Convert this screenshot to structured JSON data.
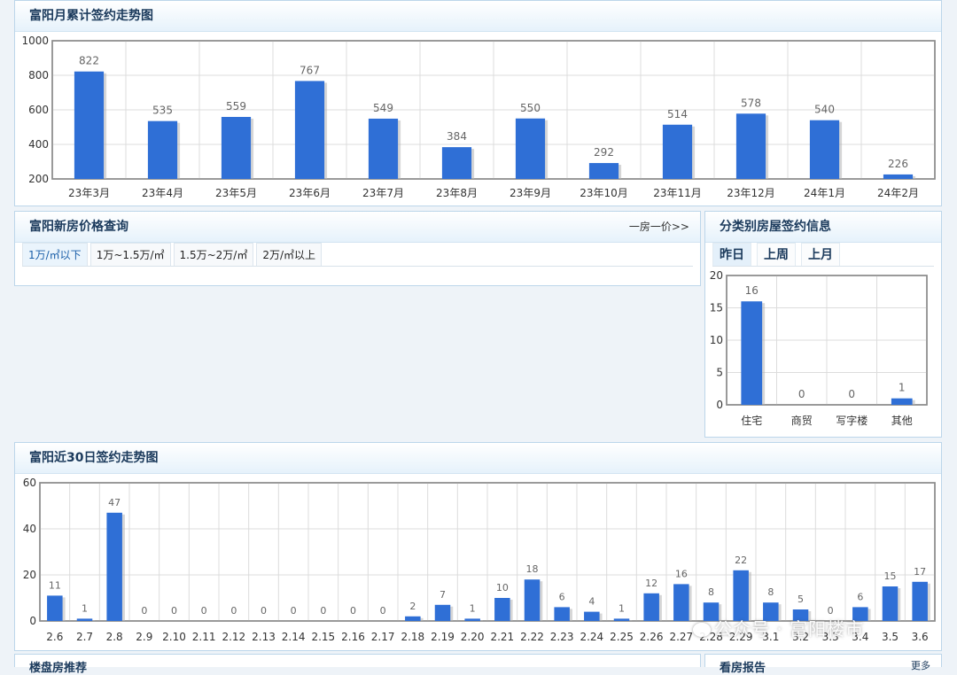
{
  "monthly": {
    "title": "富阳月累计签约走势图",
    "chart_data": {
      "type": "bar",
      "categories": [
        "23年3月",
        "23年4月",
        "23年5月",
        "23年6月",
        "23年7月",
        "23年8月",
        "23年9月",
        "23年10月",
        "23年11月",
        "23年12月",
        "24年1月",
        "24年2月"
      ],
      "values": [
        822,
        535,
        559,
        767,
        549,
        384,
        550,
        292,
        514,
        578,
        540,
        226
      ],
      "ylim": [
        200,
        1000
      ],
      "yticks": [
        200,
        400,
        600,
        800,
        1000
      ],
      "bar_color": "#2f6fd6",
      "grid": true
    }
  },
  "price_query": {
    "title": "富阳新房价格查询",
    "more": "一房一价>>",
    "tabs": [
      "1万/㎡以下",
      "1万~1.5万/㎡",
      "1.5万~2万/㎡",
      "2万/㎡以上"
    ],
    "active_tab": 0
  },
  "category": {
    "title": "分类别房屋签约信息",
    "tabs": [
      "昨日",
      "上周",
      "上月"
    ],
    "active_tab": 0,
    "chart_data": {
      "type": "bar",
      "categories": [
        "住宅",
        "商贸",
        "写字楼",
        "其他"
      ],
      "values": [
        16,
        0,
        0,
        1
      ],
      "ylim": [
        0,
        20
      ],
      "yticks": [
        0,
        5,
        10,
        15,
        20
      ],
      "bar_color": "#2f6fd6",
      "grid": true
    }
  },
  "daily": {
    "title": "富阳近30日签约走势图",
    "chart_data": {
      "type": "bar",
      "categories": [
        "2.6",
        "2.7",
        "2.8",
        "2.9",
        "2.10",
        "2.11",
        "2.12",
        "2.13",
        "2.14",
        "2.15",
        "2.16",
        "2.17",
        "2.18",
        "2.19",
        "2.20",
        "2.21",
        "2.22",
        "2.23",
        "2.24",
        "2.25",
        "2.26",
        "2.27",
        "2.28",
        "2.29",
        "3.1",
        "3.2",
        "3.3",
        "3.4",
        "3.5",
        "3.6"
      ],
      "values": [
        11,
        1,
        47,
        0,
        0,
        0,
        0,
        0,
        0,
        0,
        0,
        0,
        2,
        7,
        1,
        10,
        18,
        6,
        4,
        1,
        12,
        16,
        8,
        22,
        8,
        5,
        0,
        6,
        15,
        17
      ],
      "ylim": [
        0,
        60
      ],
      "yticks": [
        0,
        20,
        40,
        60
      ],
      "bar_color": "#2f6fd6",
      "grid": true
    }
  },
  "bottom": {
    "left_title": "楼盘房推荐",
    "right_title": "看房报告",
    "right_extra": "更多"
  },
  "watermark": "公众号 · 富阳楼市"
}
